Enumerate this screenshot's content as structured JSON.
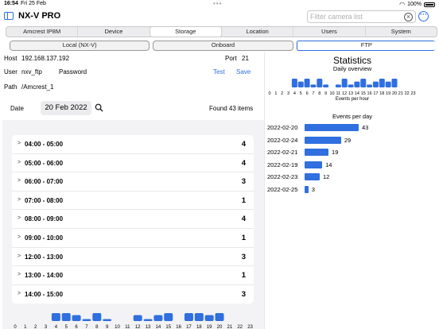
{
  "status": {
    "time": "16:54",
    "date": "Fri 25 Feb",
    "battery": "100%"
  },
  "header": {
    "title": "NX-V PRO",
    "search_placeholder": "Filter camera list"
  },
  "tabs": [
    "Amcrest IP8M",
    "Device",
    "Storage",
    "Location",
    "Users",
    "System"
  ],
  "active_tab": "Storage",
  "subtabs": [
    "Local (NX-V)",
    "Onboard",
    "FTP"
  ],
  "active_subtab": "FTP",
  "ftp": {
    "host_label": "Host",
    "host": "192.168.137.192",
    "port_label": "Port",
    "port": "21",
    "user_label": "User",
    "user": "nxv_ftp",
    "password_label": "Password",
    "test_label": "Test",
    "save_label": "Save",
    "path_label": "Path",
    "path": "/Amcrest_1"
  },
  "search": {
    "date_label": "Date",
    "date": "20 Feb 2022",
    "found": "Found 43 items"
  },
  "rows": [
    {
      "range": "04:00 - 05:00",
      "count": "4"
    },
    {
      "range": "05:00 - 06:00",
      "count": "4"
    },
    {
      "range": "06:00 - 07:00",
      "count": "3"
    },
    {
      "range": "07:00 - 08:00",
      "count": "1"
    },
    {
      "range": "08:00 - 09:00",
      "count": "4"
    },
    {
      "range": "09:00 - 10:00",
      "count": "1"
    },
    {
      "range": "12:00 - 13:00",
      "count": "3"
    },
    {
      "range": "13:00 - 14:00",
      "count": "1"
    },
    {
      "range": "14:00 - 15:00",
      "count": "3"
    }
  ],
  "hour_hist": {
    "hours": [
      "0",
      "1",
      "2",
      "3",
      "4",
      "5",
      "6",
      "7",
      "8",
      "9",
      "10",
      "11",
      "12",
      "13",
      "14",
      "15",
      "16",
      "17",
      "18",
      "19",
      "20",
      "21",
      "22",
      "23"
    ],
    "values": [
      0,
      0,
      0,
      0,
      4,
      4,
      3,
      1,
      4,
      1,
      0,
      0,
      3,
      1,
      3,
      4,
      0,
      4,
      4,
      3,
      4,
      0,
      0,
      0
    ]
  },
  "stats": {
    "title": "Statistics",
    "daily_overview": "Daily overview",
    "events_per_hour": "Events per hour",
    "events_per_day": "Events per day",
    "overview_values": [
      0,
      0,
      0,
      0,
      3,
      2,
      3,
      1,
      3,
      1,
      0,
      1,
      3,
      1,
      2,
      3,
      1,
      2,
      3,
      2,
      3,
      0,
      0,
      0
    ],
    "days": [
      {
        "date": "2022-02-20",
        "count": 43
      },
      {
        "date": "2022-02-24",
        "count": 29
      },
      {
        "date": "2022-02-21",
        "count": 19
      },
      {
        "date": "2022-02-19",
        "count": 14
      },
      {
        "date": "2022-02-23",
        "count": 12
      },
      {
        "date": "2022-02-25",
        "count": 3
      }
    ]
  },
  "colors": {
    "accent": "#2f6fe0"
  }
}
